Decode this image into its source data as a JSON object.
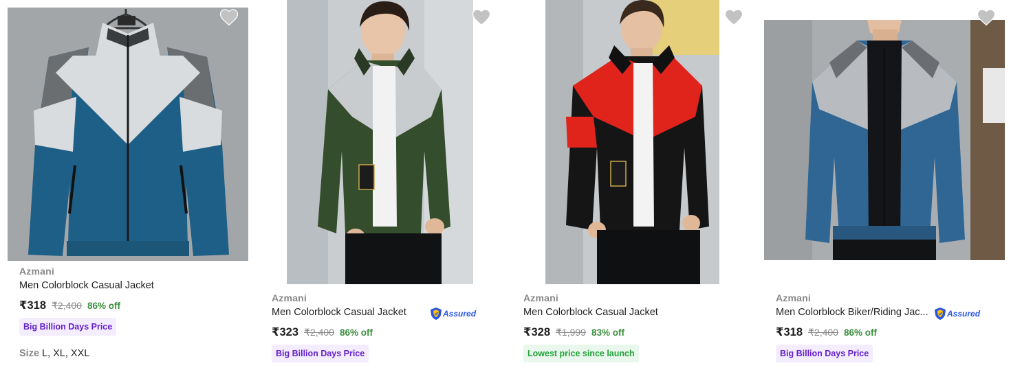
{
  "products": [
    {
      "brand": "Azmani",
      "title": "Men Colorblock Casual Jacket",
      "price": "₹318",
      "mrp": "₹2,400",
      "discount": "86% off",
      "badge": "Big Billion Days Price",
      "badge_style": "purple",
      "size_label": "Size",
      "sizes": "L, XL, XXL",
      "assured": false,
      "jacket_colors": [
        "#1d5f86",
        "#d9dcde",
        "#6b6e71"
      ]
    },
    {
      "brand": "Azmani",
      "title": "Men Colorblock Casual Jacket",
      "price": "₹323",
      "mrp": "₹2,400",
      "discount": "86% off",
      "badge": "Big Billion Days Price",
      "badge_style": "purple",
      "assured": true,
      "assured_label": "Assured",
      "jacket_colors": [
        "#344d2c",
        "#c9cccf",
        "#2a3a24"
      ]
    },
    {
      "brand": "Azmani",
      "title": "Men Colorblock Casual Jacket",
      "price": "₹328",
      "mrp": "₹1,999",
      "discount": "83% off",
      "badge": "Lowest price since launch",
      "badge_style": "green",
      "assured": false,
      "jacket_colors": [
        "#151516",
        "#e0241c",
        "#111112"
      ]
    },
    {
      "brand": "Azmani",
      "title": "Men Colorblock Biker/Riding Jac...",
      "price": "₹318",
      "mrp": "₹2,400",
      "discount": "86% off",
      "badge": "Big Billion Days Price",
      "badge_style": "purple",
      "assured": true,
      "assured_label": "Assured",
      "jacket_colors": [
        "#2f6694",
        "#b8bcc0",
        "#6a6e73"
      ]
    }
  ],
  "colors": {
    "discount_green": "#388e3c",
    "brand_gray": "#878787",
    "badge_purple_bg": "#f3edff",
    "badge_purple_text": "#6420c9",
    "badge_green_bg": "#e9f7ec",
    "badge_green_text": "#23a23a",
    "wishlist_gray": "#c2c2c2"
  },
  "icons": {
    "wishlist": "heart-icon",
    "assured": "flipkart-assured-shield-icon"
  }
}
